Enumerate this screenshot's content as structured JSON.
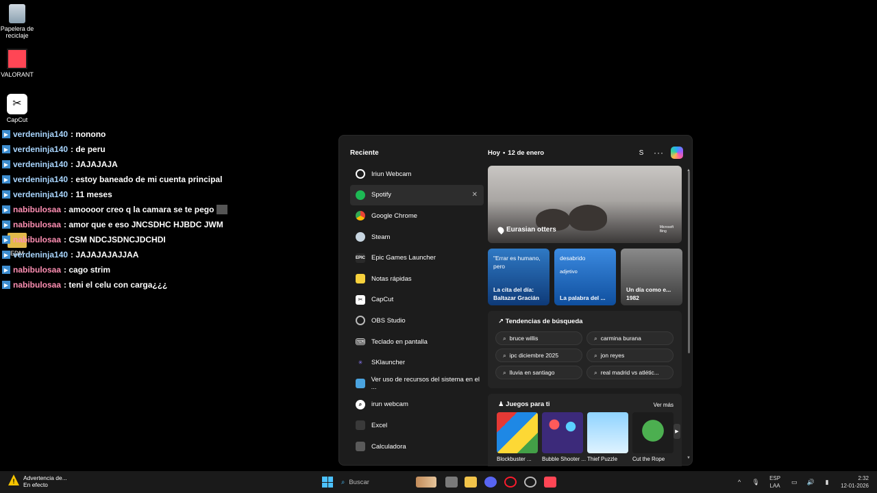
{
  "desktop": {
    "icons": [
      {
        "label": "Papelera de\nreciclaje"
      },
      {
        "label": "VALORANT"
      },
      {
        "label": "CapCut"
      },
      {
        "label": "EDM"
      }
    ]
  },
  "chat": [
    {
      "user": "verdeninja140",
      "msg": ": nonono",
      "color": "blue"
    },
    {
      "user": "verdeninja140",
      "msg": ": de peru",
      "color": "blue"
    },
    {
      "user": "verdeninja140",
      "msg": ": JAJAJAJA",
      "color": "blue"
    },
    {
      "user": "verdeninja140",
      "msg": ": estoy baneado de mi cuenta principal",
      "color": "blue"
    },
    {
      "user": "verdeninja140",
      "msg": ": 11 meses",
      "color": "blue"
    },
    {
      "user": "nabibulosaa",
      "msg": ": amoooor creo q la camara se te pego",
      "color": "pink"
    },
    {
      "user": "nabibulosaa",
      "msg": ": amor que e eso JNCSDHC HJBDC JWM",
      "color": "pink"
    },
    {
      "user": "nabibulosaa",
      "msg": ": CSM NDCJSDNCJDCHDI",
      "color": "pink"
    },
    {
      "user": "verdeninja140",
      "msg": ": JAJAJAJAJJAA",
      "color": "blue"
    },
    {
      "user": "nabibulosaa",
      "msg": ": cago strim",
      "color": "pink"
    },
    {
      "user": "nabibulosaa",
      "msg": ": teni el celu con carga¿¿¿",
      "color": "pink"
    }
  ],
  "start": {
    "recent_title": "Reciente",
    "recent": [
      {
        "label": "Iriun Webcam",
        "icon": "webcam-icon",
        "color": "#ffffff"
      },
      {
        "label": "Spotify",
        "icon": "spotify-icon",
        "color": "#1db954"
      },
      {
        "label": "Google Chrome",
        "icon": "chrome-icon",
        "color": "#ea4335"
      },
      {
        "label": "Steam",
        "icon": "steam-icon",
        "color": "#1b2838"
      },
      {
        "label": "Epic Games Launcher",
        "icon": "epic-icon",
        "color": "#2a2a2a"
      },
      {
        "label": "Notas rápidas",
        "icon": "sticky-notes-icon",
        "color": "#f7d13c"
      },
      {
        "label": "CapCut",
        "icon": "capcut-icon",
        "color": "#ffffff"
      },
      {
        "label": "OBS Studio",
        "icon": "obs-icon",
        "color": "#3a3a3a"
      },
      {
        "label": "Teclado en pantalla",
        "icon": "keyboard-icon",
        "color": "#3a3a3a"
      },
      {
        "label": "SKlauncher",
        "icon": "sklauncher-icon",
        "color": "#6b5cff"
      },
      {
        "label": "Ver uso de recursos del sistema en el ...",
        "icon": "resource-monitor-icon",
        "color": "#4aa3df"
      },
      {
        "label": "irun webcam",
        "icon": "search-icon",
        "color": "#ffffff"
      },
      {
        "label": "Excel",
        "icon": "excel-icon",
        "color": "#3a3a3a"
      },
      {
        "label": "Calculadora",
        "icon": "calculator-icon",
        "color": "#5a5a5a"
      }
    ],
    "close_glyph": "✕",
    "today": "Hoy",
    "date": "12 de enero",
    "profile_initial": "S",
    "more_glyph": "···",
    "hero_caption": "Eurasian otters",
    "hero_source": "Microsoft\nBing",
    "cards": [
      {
        "top": "\"Errar es humano, pero",
        "bottom": "La cita del día: Baltazar Gracián"
      },
      {
        "top": "desabrido",
        "small": "adjetivo",
        "bottom": "La palabra del ..."
      },
      {
        "top": "",
        "bottom": "Un día como e... 1982"
      }
    ],
    "trends_title": "Tendencias de búsqueda",
    "trends": [
      "bruce willis",
      "carmina burana",
      "ipc diciembre 2025",
      "jon reyes",
      "lluvia en santiago",
      "real madrid vs atlétic..."
    ],
    "games_title": "Juegos para ti",
    "see_more": "Ver más",
    "games": [
      "Blockbuster ...",
      "Bubble Shooter ...",
      "Thief Puzzle",
      "Cut the Rope"
    ]
  },
  "taskbar": {
    "warning_title": "Advertencia de...",
    "warning_sub": "En efecto",
    "search_placeholder": "Buscar",
    "lang_top": "ESP",
    "lang_bottom": "LAA",
    "time": "2:32",
    "date": "12-01-2026"
  }
}
